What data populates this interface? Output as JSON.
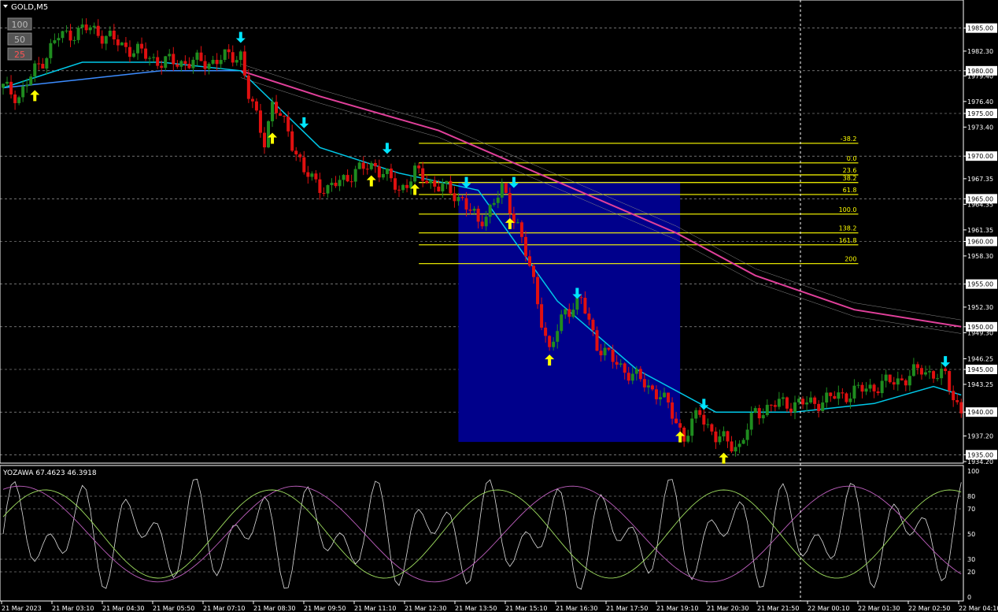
{
  "symbol_label": "GOLD,M5",
  "zoom_buttons": [
    "100",
    "50",
    "25"
  ],
  "price_axis": {
    "labels": [
      "1985.00",
      "1982.30",
      "1980.00",
      "1979.40",
      "1976.40",
      "1975.00",
      "1973.40",
      "1970.00",
      "1967.35",
      "1965.00",
      "1964.35",
      "1961.35",
      "1960.00",
      "1958.30",
      "1955.00",
      "1952.30",
      "1950.00",
      "1949.30",
      "1946.25",
      "1945.00",
      "1943.25",
      "1940.00",
      "1937.20",
      "1935.00",
      "1934.20"
    ],
    "highlighted": [
      "1985.00",
      "1980.00",
      "1975.00",
      "1970.00",
      "1965.00",
      "1960.00",
      "1955.00",
      "1950.00",
      "1945.00",
      "1940.00",
      "1935.00"
    ],
    "last_price": "1940.00"
  },
  "time_axis": [
    "21 Mar 2023",
    "21 Mar 03:10",
    "21 Mar 04:30",
    "21 Mar 05:50",
    "21 Mar 07:10",
    "21 Mar 08:30",
    "21 Mar 09:50",
    "21 Mar 11:10",
    "21 Mar 12:30",
    "21 Mar 13:50",
    "21 Mar 15:10",
    "21 Mar 16:30",
    "21 Mar 17:50",
    "21 Mar 19:10",
    "21 Mar 20:30",
    "21 Mar 21:50",
    "22 Mar 00:10",
    "22 Mar 01:30",
    "22 Mar 02:50",
    "22 Mar 04:10"
  ],
  "fib_levels": [
    "-38.2",
    "0.0",
    "23.6",
    "38.2",
    "61.8",
    "100.0",
    "138.2",
    "161.8",
    "200"
  ],
  "oscillator": {
    "title": "YOZAWA 67.4623 46.3918",
    "levels": [
      "100",
      "80",
      "70",
      "50",
      "30",
      "20",
      "0"
    ]
  },
  "colors": {
    "bull": "#1f8c1f",
    "bear": "#e01010",
    "ema_fast": "#00c8e8",
    "ema_mid": "#3c8cff",
    "ema_slow": "#e0409a",
    "fib": "#ffff00",
    "zone": "#00008b",
    "arrow_up": "#ffff00",
    "arrow_down": "#00e5ff"
  },
  "chart_data": {
    "type": "candlestick",
    "symbol": "GOLD",
    "timeframe": "M5",
    "ylim": [
      1934.2,
      1987.0
    ],
    "price_path": [
      [
        0,
        1978
      ],
      [
        4,
        1977
      ],
      [
        8,
        1980
      ],
      [
        14,
        1984
      ],
      [
        22,
        1985
      ],
      [
        30,
        1983
      ],
      [
        40,
        1981
      ],
      [
        52,
        1981
      ],
      [
        60,
        1982
      ],
      [
        62,
        1977
      ],
      [
        66,
        1972
      ],
      [
        68,
        1976
      ],
      [
        72,
        1973
      ],
      [
        76,
        1968
      ],
      [
        82,
        1966
      ],
      [
        88,
        1968
      ],
      [
        94,
        1969
      ],
      [
        100,
        1966
      ],
      [
        104,
        1968
      ],
      [
        108,
        1967
      ],
      [
        112,
        1966
      ],
      [
        116,
        1965
      ],
      [
        120,
        1962
      ],
      [
        126,
        1966
      ],
      [
        130,
        1962
      ],
      [
        134,
        1955
      ],
      [
        138,
        1947
      ],
      [
        142,
        1952
      ],
      [
        146,
        1953
      ],
      [
        150,
        1948
      ],
      [
        154,
        1946
      ],
      [
        160,
        1944
      ],
      [
        166,
        1942
      ],
      [
        170,
        1939
      ],
      [
        172,
        1937
      ],
      [
        176,
        1940
      ],
      [
        180,
        1937
      ],
      [
        186,
        1936
      ],
      [
        190,
        1940
      ],
      [
        196,
        1941
      ],
      [
        204,
        1941
      ],
      [
        212,
        1942
      ],
      [
        220,
        1943
      ],
      [
        228,
        1944
      ],
      [
        232,
        1945
      ],
      [
        238,
        1944
      ],
      [
        242,
        1940
      ]
    ],
    "ema_fast": [
      [
        0,
        1978
      ],
      [
        20,
        1981
      ],
      [
        40,
        1981
      ],
      [
        60,
        1980
      ],
      [
        80,
        1971
      ],
      [
        100,
        1968
      ],
      [
        120,
        1966
      ],
      [
        140,
        1953
      ],
      [
        160,
        1945
      ],
      [
        180,
        1940
      ],
      [
        200,
        1940
      ],
      [
        220,
        1941
      ],
      [
        235,
        1943
      ],
      [
        242,
        1942
      ]
    ],
    "ema_mid": [
      [
        0,
        1978
      ],
      [
        20,
        1979
      ],
      [
        40,
        1980
      ],
      [
        60,
        1980
      ]
    ],
    "ema_slow": [
      [
        60,
        1980
      ],
      [
        80,
        1977
      ],
      [
        110,
        1973
      ],
      [
        140,
        1967
      ],
      [
        170,
        1961
      ],
      [
        190,
        1956
      ],
      [
        215,
        1952
      ],
      [
        242,
        1950
      ]
    ],
    "fib_prices": {
      "-38.2": 1971.5,
      "0.0": 1969.2,
      "23.6": 1967.8,
      "38.2": 1966.9,
      "61.8": 1965.5,
      "100.0": 1963.2,
      "138.2": 1961.0,
      "161.8": 1959.6,
      "200": 1957.4
    },
    "zone": {
      "x_from": 115,
      "x_to": 171,
      "price_top": 1967.0,
      "price_bottom": 1936.5
    },
    "signals": [
      {
        "type": "buy",
        "bar": 8,
        "price": 1977
      },
      {
        "type": "sell",
        "bar": 60,
        "price": 1984
      },
      {
        "type": "buy",
        "bar": 68,
        "price": 1972
      },
      {
        "type": "sell",
        "bar": 76,
        "price": 1974
      },
      {
        "type": "buy",
        "bar": 93,
        "price": 1967
      },
      {
        "type": "sell",
        "bar": 97,
        "price": 1971
      },
      {
        "type": "buy",
        "bar": 104,
        "price": 1966
      },
      {
        "type": "sell",
        "bar": 117,
        "price": 1967
      },
      {
        "type": "buy",
        "bar": 128,
        "price": 1962
      },
      {
        "type": "sell",
        "bar": 129,
        "price": 1967
      },
      {
        "type": "buy",
        "bar": 138,
        "price": 1946
      },
      {
        "type": "sell",
        "bar": 145,
        "price": 1954
      },
      {
        "type": "buy",
        "bar": 171,
        "price": 1937
      },
      {
        "type": "sell",
        "bar": 177,
        "price": 1941
      },
      {
        "type": "buy",
        "bar": 182,
        "price": 1934.5
      },
      {
        "type": "sell",
        "bar": 238,
        "price": 1946
      }
    ],
    "oscillator_series": {
      "fast_peaks": "white oscillating line 0-100",
      "signal_lines": [
        "#c060c0",
        "#a0e060"
      ]
    }
  }
}
